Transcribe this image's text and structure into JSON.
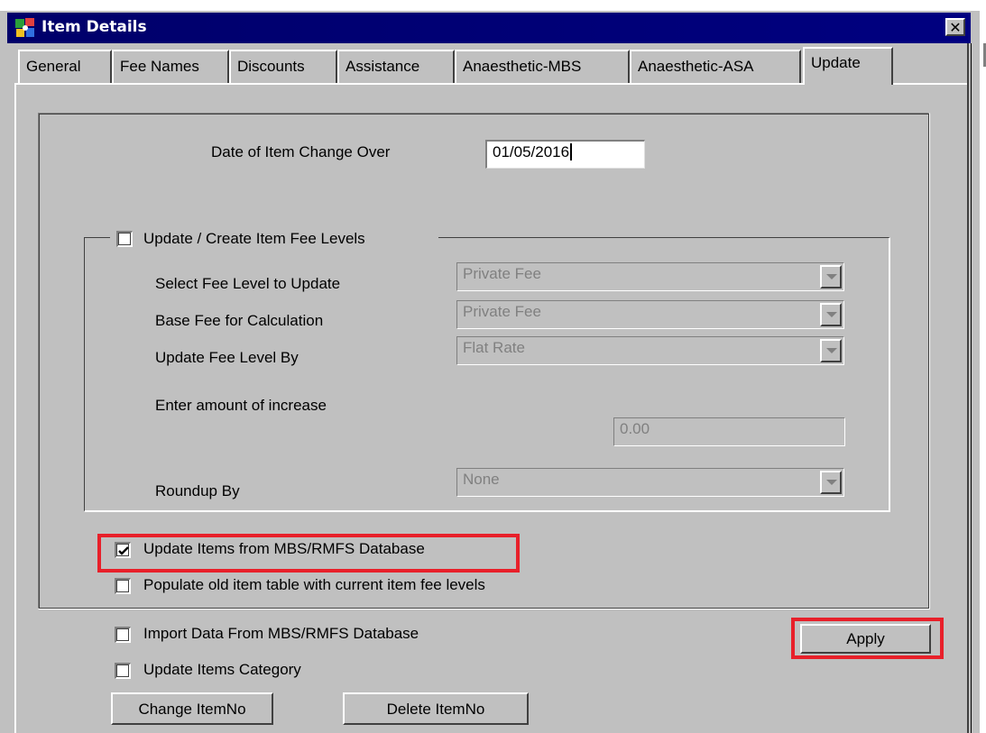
{
  "window": {
    "title": "Item Details",
    "close_glyph": "✕"
  },
  "tabs": [
    {
      "label": "General"
    },
    {
      "label": "Fee Names"
    },
    {
      "label": "Discounts"
    },
    {
      "label": "Assistance"
    },
    {
      "label": "Anaesthetic-MBS"
    },
    {
      "label": "Anaesthetic-ASA"
    },
    {
      "label": "Update",
      "active": true
    }
  ],
  "update": {
    "date_label": "Date of Item Change Over",
    "date_value": "01/05/2016",
    "fee_levels": {
      "checkbox_label": "Update / Create Item Fee Levels",
      "checked": false,
      "select_fee_level_label": "Select Fee Level to Update",
      "select_fee_level_value": "Private Fee",
      "base_fee_label": "Base Fee for Calculation",
      "base_fee_value": "Private Fee",
      "update_by_label": "Update Fee Level By",
      "update_by_value": "Flat Rate",
      "increase_label": "Enter amount of increase",
      "increase_value": "0.00",
      "roundup_label": "Roundup By",
      "roundup_value": "None"
    },
    "update_items_mbs": {
      "label": "Update Items from MBS/RMFS Database",
      "checked": true
    },
    "populate_old": {
      "label": "Populate old item table with current item fee levels",
      "checked": false
    },
    "import_data": {
      "label": "Import Data From MBS/RMFS Database",
      "checked": false
    },
    "update_category": {
      "label": "Update Items Category",
      "checked": false
    },
    "apply_label": "Apply",
    "change_itemno_label": "Change ItemNo",
    "delete_itemno_label": "Delete ItemNo"
  },
  "colors": {
    "titlebar": "#000080",
    "highlight": "#e8202a",
    "face": "#c0c0c0"
  },
  "icons": [
    "app-icon",
    "close-icon",
    "dropdown-arrow-icon",
    "checkmark-icon"
  ]
}
